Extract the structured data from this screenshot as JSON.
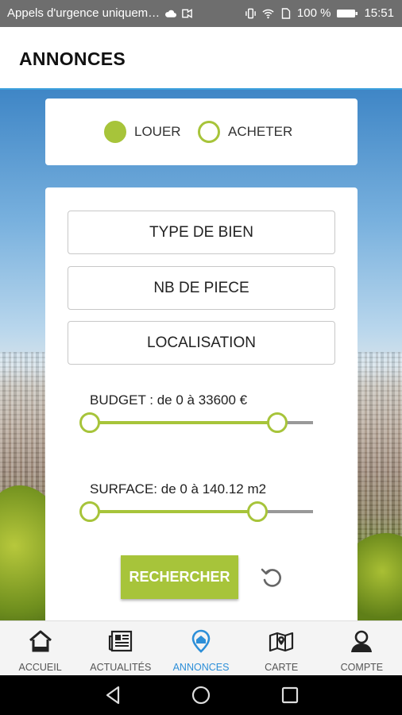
{
  "status_bar": {
    "carrier": "Appels d'urgence uniquem…",
    "battery": "100 %",
    "time": "15:51"
  },
  "header": {
    "title": "ANNONCES"
  },
  "transaction_type": {
    "options": [
      {
        "label": "LOUER",
        "selected": true
      },
      {
        "label": "ACHETER",
        "selected": false
      }
    ]
  },
  "filters": {
    "property_type": "TYPE DE BIEN",
    "rooms": "NB DE PIECE",
    "location": "LOCALISATION"
  },
  "budget": {
    "label": "BUDGET : de 0 à 33600 €",
    "min_fraction": 0.0,
    "max_fraction": 0.84
  },
  "surface": {
    "label": "SURFACE: de 0 à 140.12 m2",
    "min_fraction": 0.0,
    "max_fraction": 0.75
  },
  "actions": {
    "search_label": "RECHERCHER"
  },
  "bottom_nav": {
    "items": [
      {
        "label": "ACCUEIL",
        "icon": "home-icon"
      },
      {
        "label": "ACTUALITÉS",
        "icon": "news-icon"
      },
      {
        "label": "ANNONCES",
        "icon": "location-pin-icon",
        "active": true
      },
      {
        "label": "CARTE",
        "icon": "map-icon"
      },
      {
        "label": "COMPTE",
        "icon": "user-icon"
      }
    ]
  },
  "colors": {
    "accent": "#a7c43a",
    "active_nav": "#2d8fd8",
    "header_border": "#3ca0dc"
  }
}
